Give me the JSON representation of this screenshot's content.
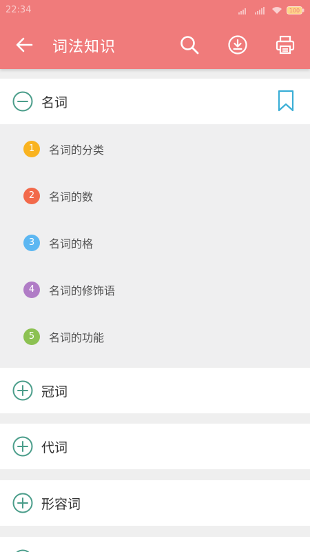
{
  "status": {
    "time": "22:34",
    "battery": "100"
  },
  "header": {
    "title": "词法知识"
  },
  "sections": [
    {
      "label": "名词",
      "expanded": true,
      "items": [
        {
          "num": "1",
          "label": "名词的分类",
          "color": "#f9b320"
        },
        {
          "num": "2",
          "label": "名词的数",
          "color": "#f2694a"
        },
        {
          "num": "3",
          "label": "名词的格",
          "color": "#5cb7f2"
        },
        {
          "num": "4",
          "label": "名词的修饰语",
          "color": "#b07cc6"
        },
        {
          "num": "5",
          "label": "名词的功能",
          "color": "#8cc152"
        }
      ]
    },
    {
      "label": "冠词",
      "expanded": false
    },
    {
      "label": "代词",
      "expanded": false
    },
    {
      "label": "形容词",
      "expanded": false
    }
  ],
  "colors": {
    "header": "#f07b7b",
    "accent": "#4a9d8a",
    "bookmark": "#3aaed6"
  }
}
